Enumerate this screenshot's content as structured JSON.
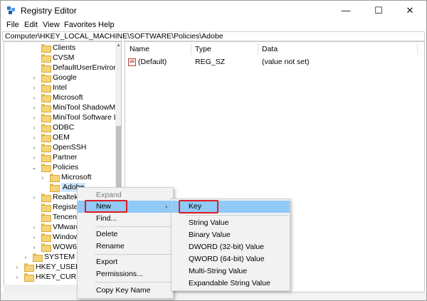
{
  "window": {
    "title": "Registry Editor",
    "controls": {
      "minimize": "—",
      "maximize": "☐",
      "close": "✕"
    }
  },
  "menubar": [
    "File",
    "Edit",
    "View",
    "Favorites",
    "Help"
  ],
  "address": "Computer\\HKEY_LOCAL_MACHINE\\SOFTWARE\\Policies\\Adobe",
  "tree": [
    {
      "label": "Clients",
      "expander": ""
    },
    {
      "label": "CVSM",
      "expander": ""
    },
    {
      "label": "DefaultUserEnvironn",
      "expander": ""
    },
    {
      "label": "Google",
      "expander": "›"
    },
    {
      "label": "Intel",
      "expander": "›"
    },
    {
      "label": "Microsoft",
      "expander": "›"
    },
    {
      "label": "MiniTool ShadowMa",
      "expander": "›"
    },
    {
      "label": "MiniTool Software Li",
      "expander": "›"
    },
    {
      "label": "ODBC",
      "expander": "›"
    },
    {
      "label": "OEM",
      "expander": "›"
    },
    {
      "label": "OpenSSH",
      "expander": "›"
    },
    {
      "label": "Partner",
      "expander": "›"
    },
    {
      "label": "Policies",
      "expander": "⌄"
    },
    {
      "label": "Microsoft",
      "expander": "›"
    },
    {
      "label": "Adobe",
      "expander": ""
    },
    {
      "label": "Realtek",
      "expander": "›"
    },
    {
      "label": "Registere",
      "expander": ""
    },
    {
      "label": "Tencent",
      "expander": ""
    },
    {
      "label": "VMware,",
      "expander": "›"
    },
    {
      "label": "Window",
      "expander": "›"
    },
    {
      "label": "WOW643",
      "expander": "›"
    },
    {
      "label": "SYSTEM",
      "expander": "›"
    },
    {
      "label": "HKEY_USERS",
      "expander": "›"
    },
    {
      "label": "HKEY_CURREN",
      "expander": "›"
    }
  ],
  "values": {
    "columns": [
      "Name",
      "Type",
      "Data"
    ],
    "rows": [
      {
        "name": "(Default)",
        "type": "REG_SZ",
        "data": "(value not set)",
        "icon": "ab"
      }
    ]
  },
  "context_menu": {
    "items": [
      "Expand",
      "New",
      "Find...",
      "Delete",
      "Rename",
      "Export",
      "Permissions...",
      "Copy Key Name"
    ],
    "submenu_arrow": "›"
  },
  "submenu": {
    "items": [
      "Key",
      "String Value",
      "Binary Value",
      "DWORD (32-bit) Value",
      "QWORD (64-bit) Value",
      "Multi-String Value",
      "Expandable String Value"
    ]
  },
  "colors": {
    "highlight": "#91c9f7",
    "annotation": "#e0191f",
    "folder": "#f3d479"
  }
}
